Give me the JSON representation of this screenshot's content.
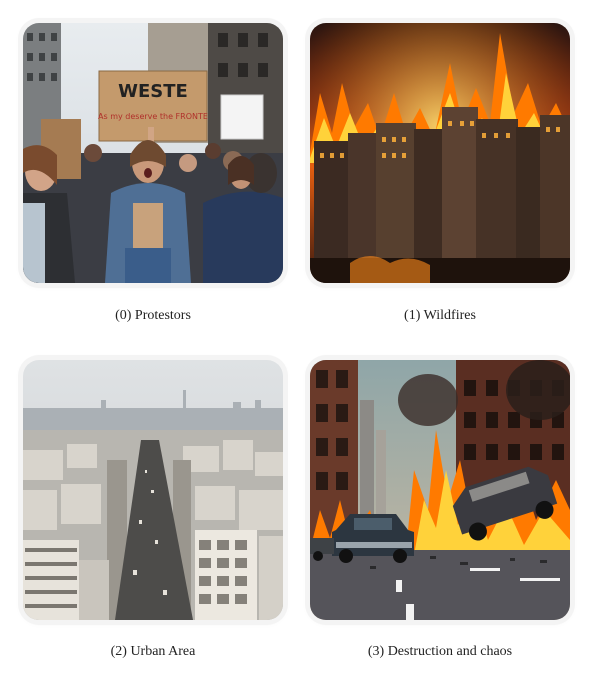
{
  "grid": {
    "items": [
      {
        "index": 0,
        "caption": "(0) Protestors",
        "image_kind": "photo-protestors",
        "sign_text": "WESTE",
        "sign_subtext": "As my deserve the FRONTE"
      },
      {
        "index": 1,
        "caption": "(1) Wildfires",
        "image_kind": "photo-wildfire-city"
      },
      {
        "index": 2,
        "caption": "(2) Urban Area",
        "image_kind": "photo-urban-aerial"
      },
      {
        "index": 3,
        "caption": "(3) Destruction and chaos",
        "image_kind": "photo-burning-street"
      }
    ]
  },
  "colors": {
    "background": "#ffffff",
    "caption_text": "#222222",
    "fire_orange": "#ff7a00",
    "fire_yellow": "#ffd23a",
    "smoke_dark": "#2a1a14",
    "haze_sky": "#d9dde0"
  }
}
